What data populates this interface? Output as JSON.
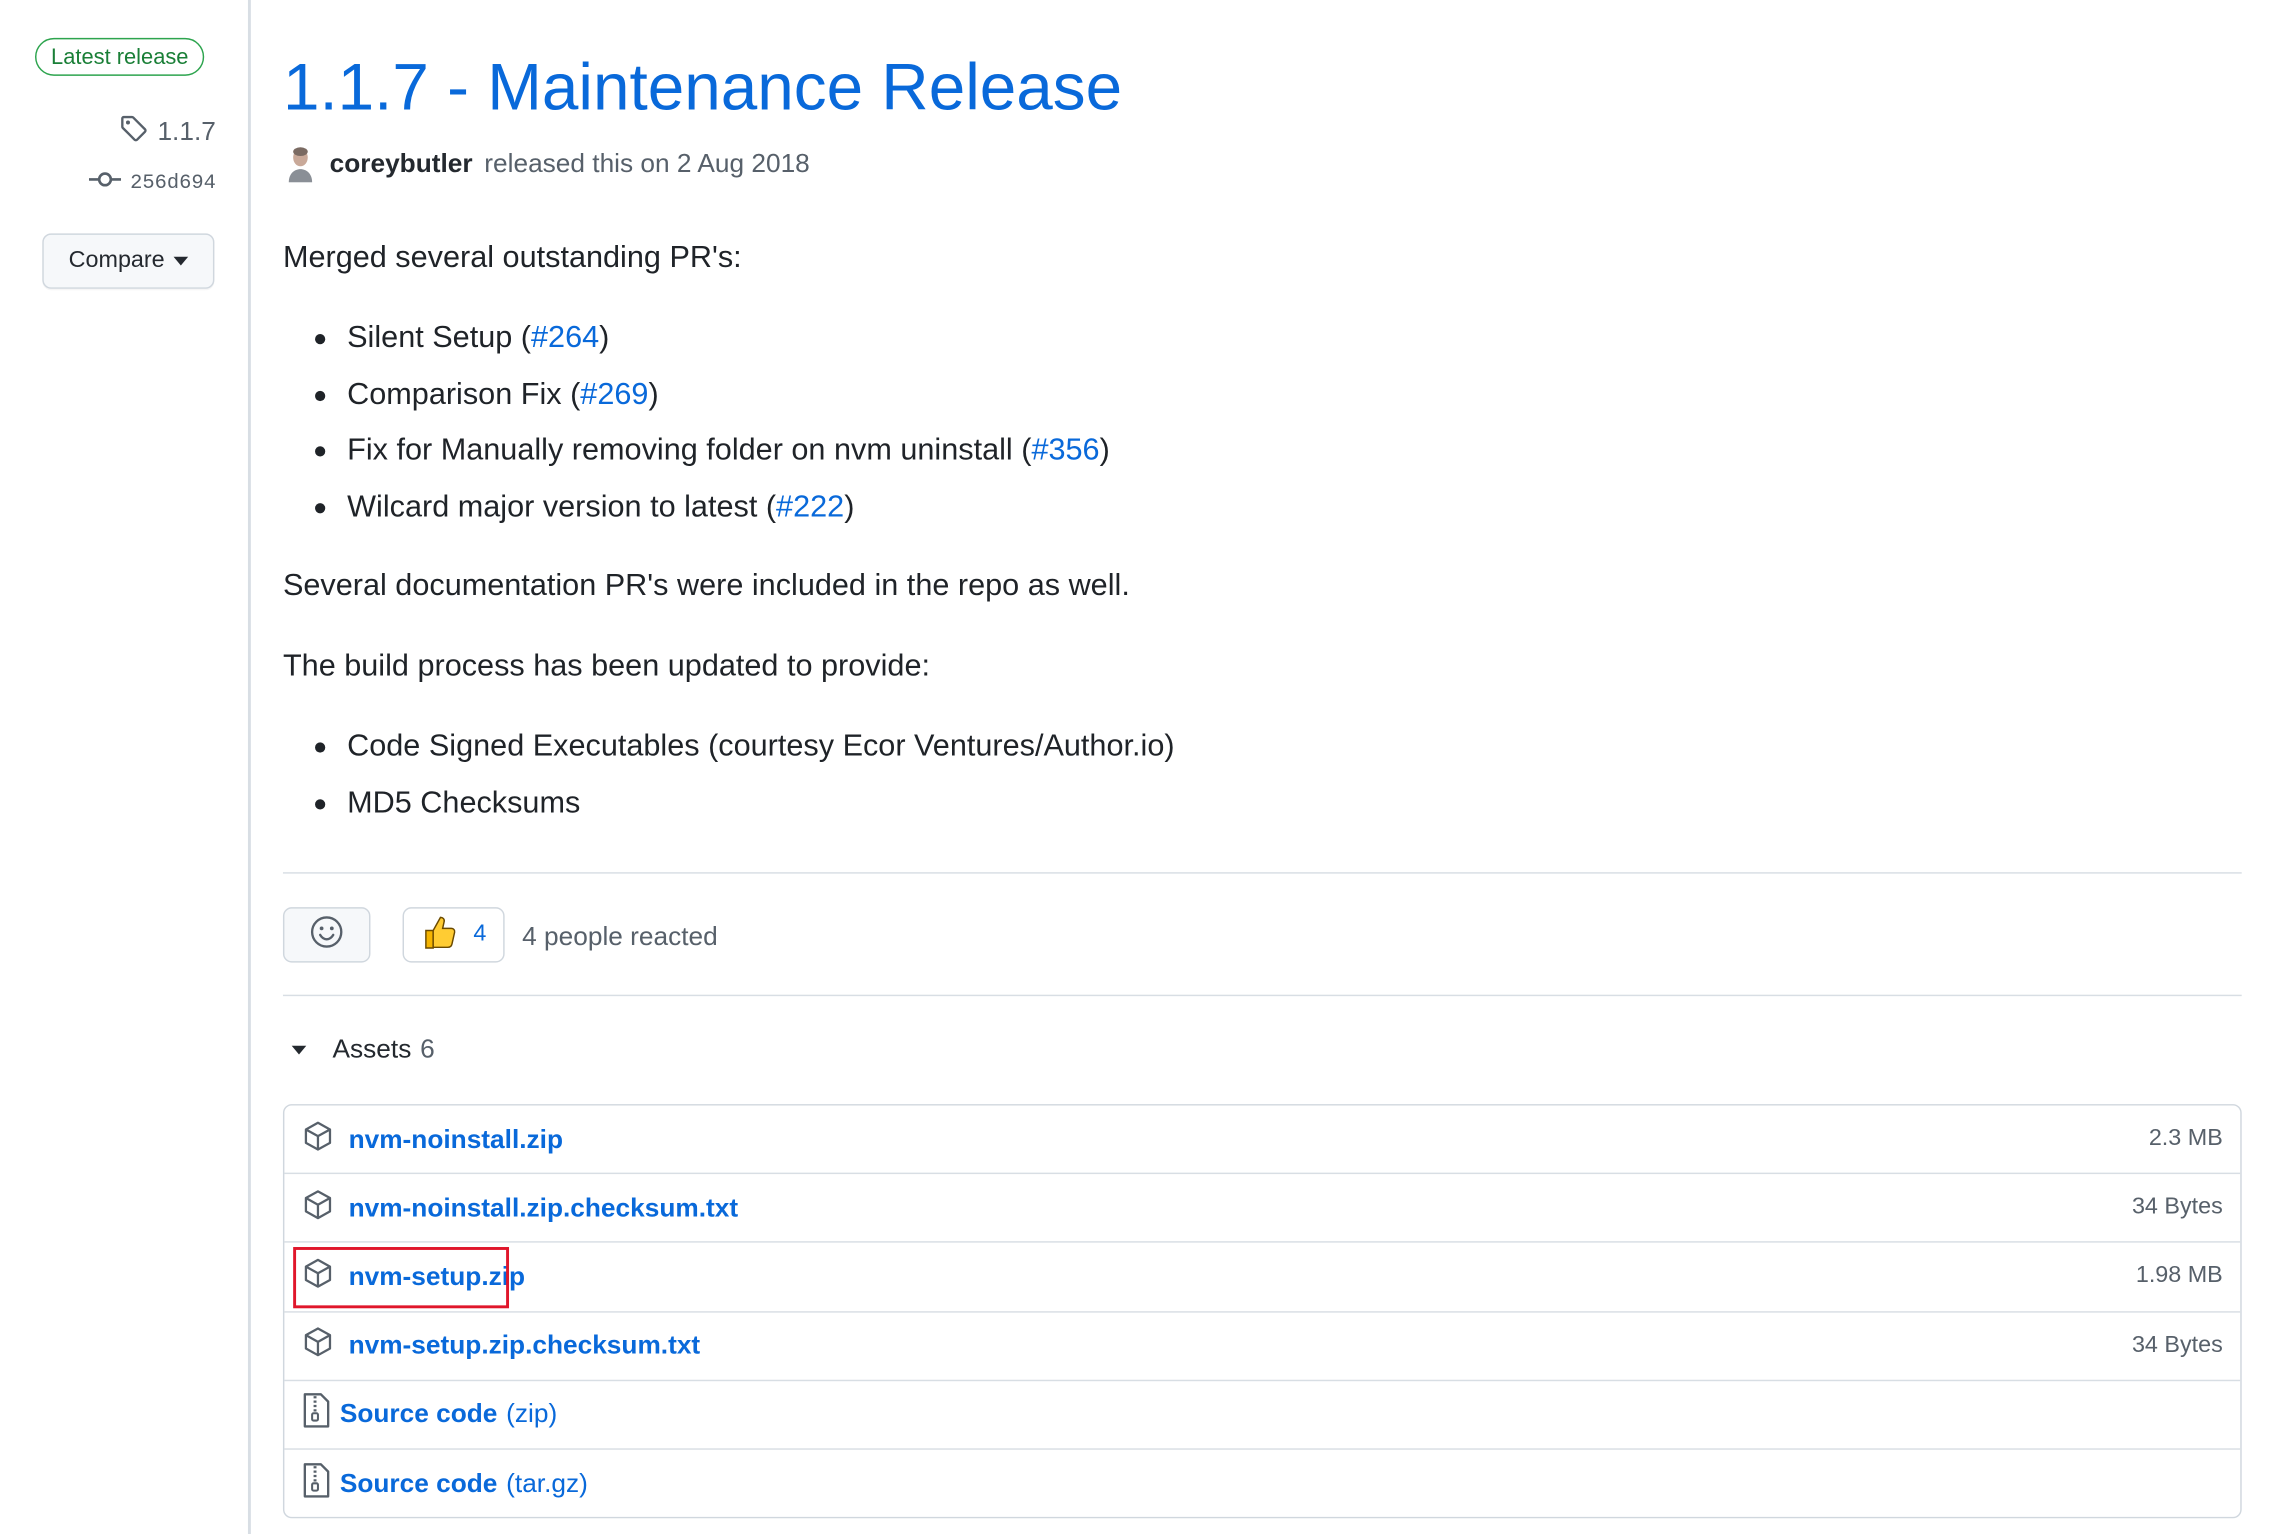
{
  "sidebar": {
    "latest_badge": "Latest release",
    "tag": "1.1.7",
    "commit": "256d694",
    "compare_label": "Compare"
  },
  "release": {
    "title": "1.1.7 - Maintenance Release",
    "author": "coreybutler",
    "released_text": "released this on 2 Aug 2018"
  },
  "body": {
    "intro": "Merged several outstanding PR's:",
    "prs": [
      {
        "text": "Silent Setup (",
        "link": "#264",
        "close": ")"
      },
      {
        "text": "Comparison Fix (",
        "link": "#269",
        "close": ")"
      },
      {
        "text": "Fix for Manually removing folder on nvm uninstall (",
        "link": "#356",
        "close": ")"
      },
      {
        "text": "Wilcard major version to latest (",
        "link": "#222",
        "close": ")"
      }
    ],
    "docs_note": "Several documentation PR's were included in the repo as well.",
    "build_intro": "The build process has been updated to provide:",
    "build_items": [
      "Code Signed Executables (courtesy Ecor Ventures/Author.io)",
      "MD5 Checksums"
    ]
  },
  "reactions": {
    "thumbs_count": "4",
    "summary": "4 people reacted"
  },
  "assets": {
    "label": "Assets",
    "count": "6",
    "items": [
      {
        "name": "nvm-noinstall.zip",
        "suffix": "",
        "size": "2.3 MB",
        "icon": "package-icon"
      },
      {
        "name": "nvm-noinstall.zip.checksum.txt",
        "suffix": "",
        "size": "34 Bytes",
        "icon": "package-icon"
      },
      {
        "name": "nvm-setup.zip",
        "suffix": "",
        "size": "1.98 MB",
        "icon": "package-icon",
        "highlighted": true
      },
      {
        "name": "nvm-setup.zip.checksum.txt",
        "suffix": "",
        "size": "34 Bytes",
        "icon": "package-icon"
      },
      {
        "name": "Source code",
        "suffix": "(zip)",
        "size": "",
        "icon": "file-zip-icon"
      },
      {
        "name": "Source code",
        "suffix": "(tar.gz)",
        "size": "",
        "icon": "file-zip-icon"
      }
    ]
  },
  "colors": {
    "link": "#0969da",
    "badge_green": "#1a7f37",
    "highlight_red": "#e0162b"
  }
}
